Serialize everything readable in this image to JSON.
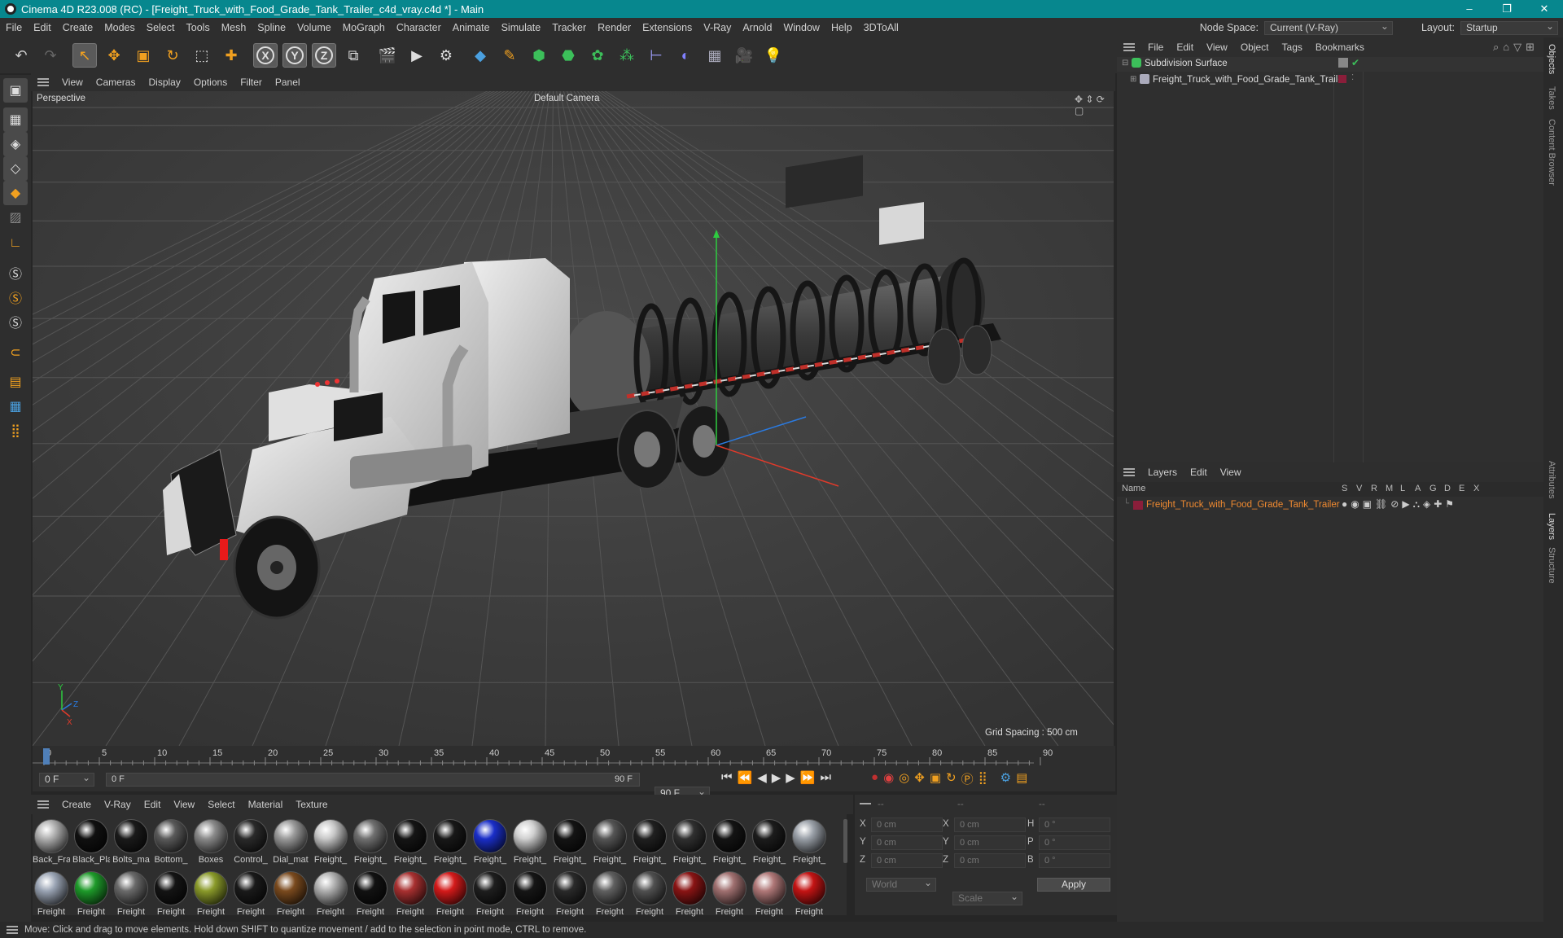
{
  "app": {
    "title": "Cinema 4D R23.008 (RC) - [Freight_Truck_with_Food_Grade_Tank_Trailer_c4d_vray.c4d *] - Main",
    "window_buttons": [
      "–",
      "❐",
      "✕"
    ]
  },
  "menubar": {
    "items": [
      "File",
      "Edit",
      "Create",
      "Modes",
      "Select",
      "Tools",
      "Mesh",
      "Spline",
      "Volume",
      "MoGraph",
      "Character",
      "Animate",
      "Simulate",
      "Tracker",
      "Render",
      "Extensions",
      "V-Ray",
      "Arnold",
      "Window",
      "Help",
      "3DToAll"
    ],
    "node_space_label": "Node Space:",
    "node_space_value": "Current (V-Ray)",
    "layout_label": "Layout:",
    "layout_value": "Startup"
  },
  "toolbar": {
    "icons": [
      "undo-icon",
      "redo-icon",
      "live-select-icon",
      "move-icon",
      "scale-icon",
      "rotate-icon",
      "recent-tool-icon",
      "add-icon",
      "x-axis-icon",
      "y-axis-icon",
      "z-axis-icon",
      "coordinate-system-icon",
      "render-view-icon",
      "render-picture-viewer-icon",
      "render-settings-icon",
      "cube-icon",
      "pen-icon",
      "subdivision-icon",
      "extrude-icon",
      "cloner-icon",
      "array-icon",
      "symmetry-icon",
      "deformer-icon",
      "floor-icon",
      "camera-icon",
      "light-icon"
    ],
    "axis_labels": [
      "X",
      "Y",
      "Z"
    ]
  },
  "viewport": {
    "menu": [
      "View",
      "Cameras",
      "Display",
      "Options",
      "Filter",
      "Panel"
    ],
    "projection": "Perspective",
    "camera": "Default Camera",
    "grid_spacing": "Grid Spacing : 500 cm",
    "axis_labels": [
      "Y",
      "Z",
      "X"
    ]
  },
  "timeline": {
    "ticks": [
      "0",
      "5",
      "10",
      "15",
      "20",
      "25",
      "30",
      "35",
      "40",
      "45",
      "50",
      "55",
      "60",
      "65",
      "70",
      "75",
      "80",
      "85",
      "90"
    ],
    "current_frame": "0 F",
    "start_frame": "0 F",
    "range_start": "0 F",
    "range_end": "90 F",
    "end_frame": "90 F"
  },
  "materials": {
    "menu": [
      "Create",
      "V-Ray",
      "Edit",
      "View",
      "Select",
      "Material",
      "Texture"
    ],
    "row1": [
      {
        "label": "Back_Fra",
        "color": "#b0b0b0"
      },
      {
        "label": "Black_Pla",
        "color": "#101010"
      },
      {
        "label": "Bolts_ma",
        "color": "#1a1a1a"
      },
      {
        "label": "Bottom_",
        "color": "#5a5a5a"
      },
      {
        "label": "Boxes",
        "color": "#8a8a8a"
      },
      {
        "label": "Control_",
        "color": "#2a2a2a"
      },
      {
        "label": "Dial_mat",
        "color": "#9a9a9a"
      },
      {
        "label": "Freight_",
        "color": "#c8c8c8"
      },
      {
        "label": "Freight_",
        "color": "#707070"
      },
      {
        "label": "Freight_",
        "color": "#151515"
      },
      {
        "label": "Freight_",
        "color": "#181818"
      },
      {
        "label": "Freight_",
        "color": "#1a2ec8"
      },
      {
        "label": "Freight_",
        "color": "#d0d0d0"
      },
      {
        "label": "Freight_",
        "color": "#141414"
      },
      {
        "label": "Freight_",
        "color": "#555555"
      },
      {
        "label": "Freight_",
        "color": "#202020"
      },
      {
        "label": "Freight_",
        "color": "#303030"
      },
      {
        "label": "Freight_",
        "color": "#141414"
      },
      {
        "label": "Freight_",
        "color": "#1c1c1c"
      },
      {
        "label": "Freight_",
        "color": "#9aa0a8"
      }
    ],
    "row2": [
      {
        "label": "Freight",
        "color": "#9aa4b4"
      },
      {
        "label": "Freight",
        "color": "#1e9a2a"
      },
      {
        "label": "Freight",
        "color": "#6a6a6a"
      },
      {
        "label": "Freight",
        "color": "#141414"
      },
      {
        "label": "Freight",
        "color": "#8a9a2a"
      },
      {
        "label": "Freight",
        "color": "#1a1a1a"
      },
      {
        "label": "Freight",
        "color": "#7a4a1e"
      },
      {
        "label": "Freight",
        "color": "#b0b0b0"
      },
      {
        "label": "Freight",
        "color": "#121212"
      },
      {
        "label": "Freight",
        "color": "#a83030"
      },
      {
        "label": "Freight",
        "color": "#d41a1a"
      },
      {
        "label": "Freight",
        "color": "#1e1e1e"
      },
      {
        "label": "Freight",
        "color": "#161616"
      },
      {
        "label": "Freight",
        "color": "#2a2a2a"
      },
      {
        "label": "Freight",
        "color": "#606060"
      },
      {
        "label": "Freight",
        "color": "#505050"
      },
      {
        "label": "Freight",
        "color": "#8a1414"
      },
      {
        "label": "Freight",
        "color": "#a07070"
      },
      {
        "label": "Freight",
        "color": "#b07878"
      },
      {
        "label": "Freight",
        "color": "#c41414"
      }
    ]
  },
  "coords": {
    "headers": [
      "--",
      "--",
      "--"
    ],
    "rows": [
      {
        "a": "X",
        "av": "0 cm",
        "b": "X",
        "bv": "0 cm",
        "c": "H",
        "cv": "0 °"
      },
      {
        "a": "Y",
        "av": "0 cm",
        "b": "Y",
        "bv": "0 cm",
        "c": "P",
        "cv": "0 °"
      },
      {
        "a": "Z",
        "av": "0 cm",
        "b": "Z",
        "bv": "0 cm",
        "c": "B",
        "cv": "0 °"
      }
    ],
    "space": "World",
    "mode": "Scale",
    "apply": "Apply"
  },
  "objects": {
    "menu": [
      "File",
      "Edit",
      "View",
      "Object",
      "Tags",
      "Bookmarks"
    ],
    "items": [
      {
        "name": "Subdivision Surface"
      },
      {
        "name": "Freight_Truck_with_Food_Grade_Tank_Trailer"
      }
    ]
  },
  "layers": {
    "menu": [
      "Layers",
      "Edit",
      "View"
    ],
    "columns": [
      "Name",
      "S",
      "V",
      "R",
      "M",
      "L",
      "A",
      "G",
      "D",
      "E",
      "X"
    ],
    "items": [
      {
        "name": "Freight_Truck_with_Food_Grade_Tank_Trailer",
        "color": "#8a1e3a"
      }
    ]
  },
  "sidetabs": [
    "Objects",
    "Takes",
    "Content Browser",
    "Attributes",
    "Layers",
    "Structure"
  ],
  "status": "Move: Click and drag to move elements. Hold down SHIFT to quantize movement / add to the selection in point mode, CTRL to remove.",
  "colors": {
    "accent": "#07878e",
    "highlight": "#f08a30"
  }
}
